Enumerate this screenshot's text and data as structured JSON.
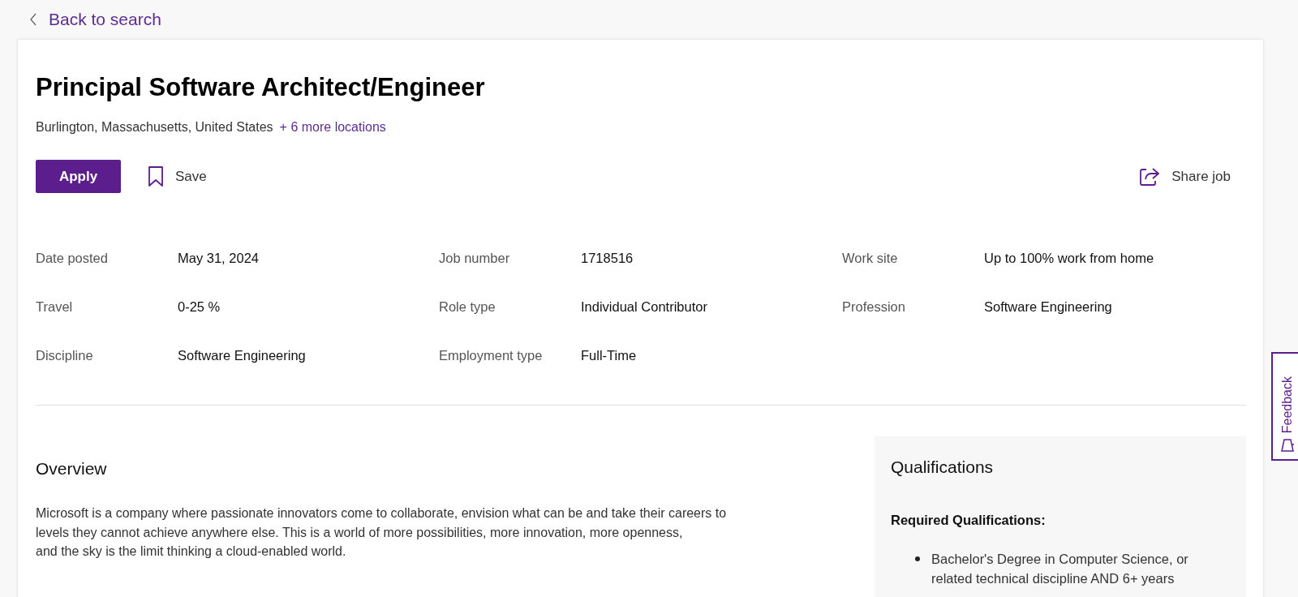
{
  "back_link": "Back to search",
  "job": {
    "title": "Principal Software Architect/Engineer",
    "location": "Burlington, Massachusetts, United States",
    "more_locations": "+ 6 more locations"
  },
  "actions": {
    "apply": "Apply",
    "save": "Save",
    "share": "Share job"
  },
  "details": [
    {
      "label": "Date posted",
      "value": "May 31, 2024"
    },
    {
      "label": "Job number",
      "value": "1718516"
    },
    {
      "label": "Work site",
      "value": "Up to 100% work from home"
    },
    {
      "label": "Travel",
      "value": "0-25 %"
    },
    {
      "label": "Role type",
      "value": "Individual Contributor"
    },
    {
      "label": "Profession",
      "value": "Software Engineering"
    },
    {
      "label": "Discipline",
      "value": "Software Engineering"
    },
    {
      "label": "Employment type",
      "value": "Full-Time"
    }
  ],
  "overview": {
    "heading": "Overview",
    "paragraph_lines": [
      "Microsoft is a company where passionate innovators come to collaborate, envision what can be and take their careers to",
      "levels they cannot achieve anywhere else. This is a world of more possibilities, more innovation, more openness,",
      "and the sky is the limit thinking a cloud-enabled world."
    ]
  },
  "qualifications": {
    "heading": "Qualifications",
    "subheading": "Required Qualifications:",
    "items": [
      {
        "lines": [
          "Bachelor's Degree in Computer Science, or",
          "related technical discipline AND 6+ years"
        ]
      }
    ]
  },
  "feedback": "Feedback"
}
